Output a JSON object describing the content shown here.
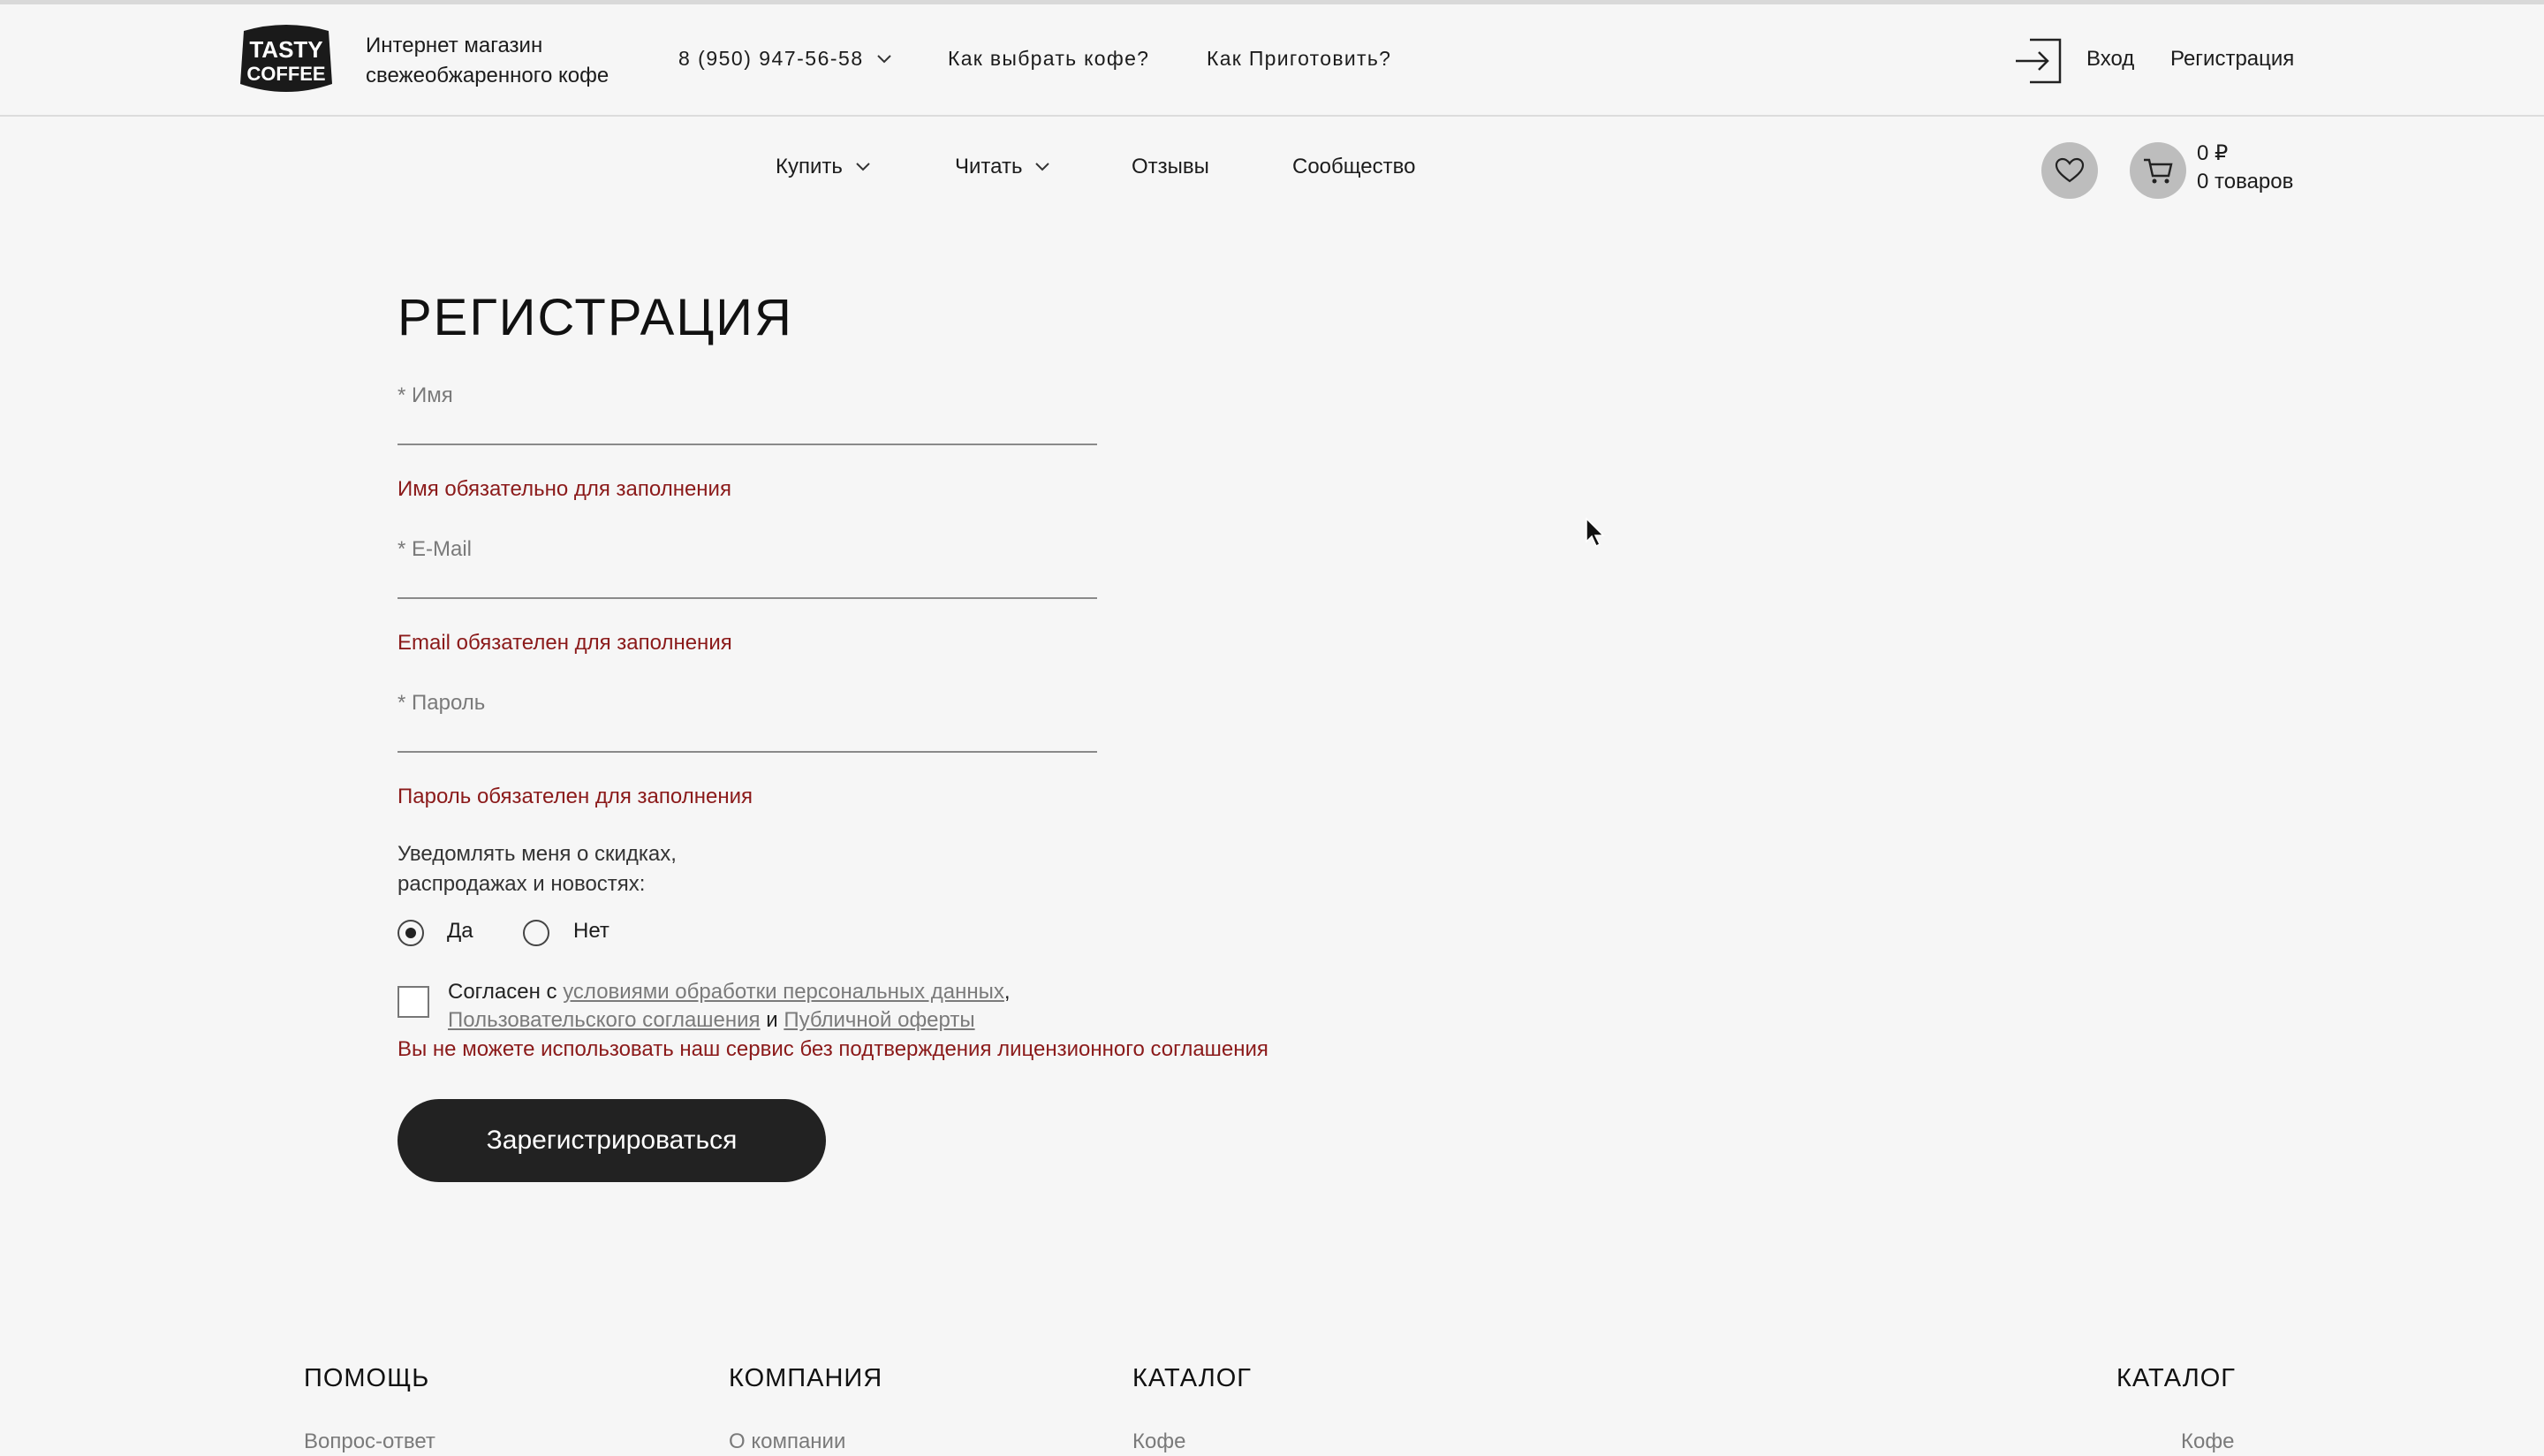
{
  "header": {
    "brand_line1": "TASTY",
    "brand_line2": "COFFEE",
    "tagline_line1": "Интернет магазин",
    "tagline_line2": "свежеобжаренного кофе",
    "phone": "8 (950) 947-56-58",
    "links": [
      "Как выбрать кофе?",
      "Как Приготовить?"
    ],
    "login": "Вход",
    "register": "Регистрация"
  },
  "nav": {
    "items": [
      "Купить",
      "Читать",
      "Отзывы",
      "Сообщество"
    ]
  },
  "cart": {
    "sum": "0 ₽",
    "count": "0 товаров"
  },
  "form": {
    "title": "РЕГИСТРАЦИЯ",
    "name_label": "* Имя",
    "name_error": "Имя обязательно для заполнения",
    "email_label": "* E-Mail",
    "email_error": "Email обязателен для заполнения",
    "password_label": "* Пароль",
    "password_error": "Пароль обязателен для заполнения",
    "notify_line1": "Уведомлять меня о скидках,",
    "notify_line2": "распродажах и новостях:",
    "radio_yes": "Да",
    "radio_no": "Нет",
    "agree_prefix": "Согласен с",
    "agree_link1": "условиями обработки персональных данных",
    "agree_comma": ",",
    "agree_link2": "Пользовательского соглашения",
    "agree_and": "и",
    "agree_link3": "Публичной оферты",
    "license_error": "Вы не можете использовать наш сервис без подтверждения лицензионного соглашения",
    "submit": "Зарегистрироваться"
  },
  "footer": {
    "columns": [
      {
        "title": "ПОМОЩЬ",
        "link": "Вопрос-ответ"
      },
      {
        "title": "КОМПАНИЯ",
        "link": "О компании"
      },
      {
        "title": "КАТАЛОГ",
        "link": "Кофе"
      },
      {
        "title": "КАТАЛОГ",
        "link": "Кофе"
      }
    ]
  },
  "colors": {
    "background": "#f6f6f6",
    "error": "#8b1a1a",
    "button": "#222222",
    "icon_circle": "#bdbdbd"
  },
  "icons": [
    "logo-icon",
    "chevron-down-icon",
    "login-icon",
    "heart-icon",
    "cart-icon",
    "cursor-icon"
  ]
}
